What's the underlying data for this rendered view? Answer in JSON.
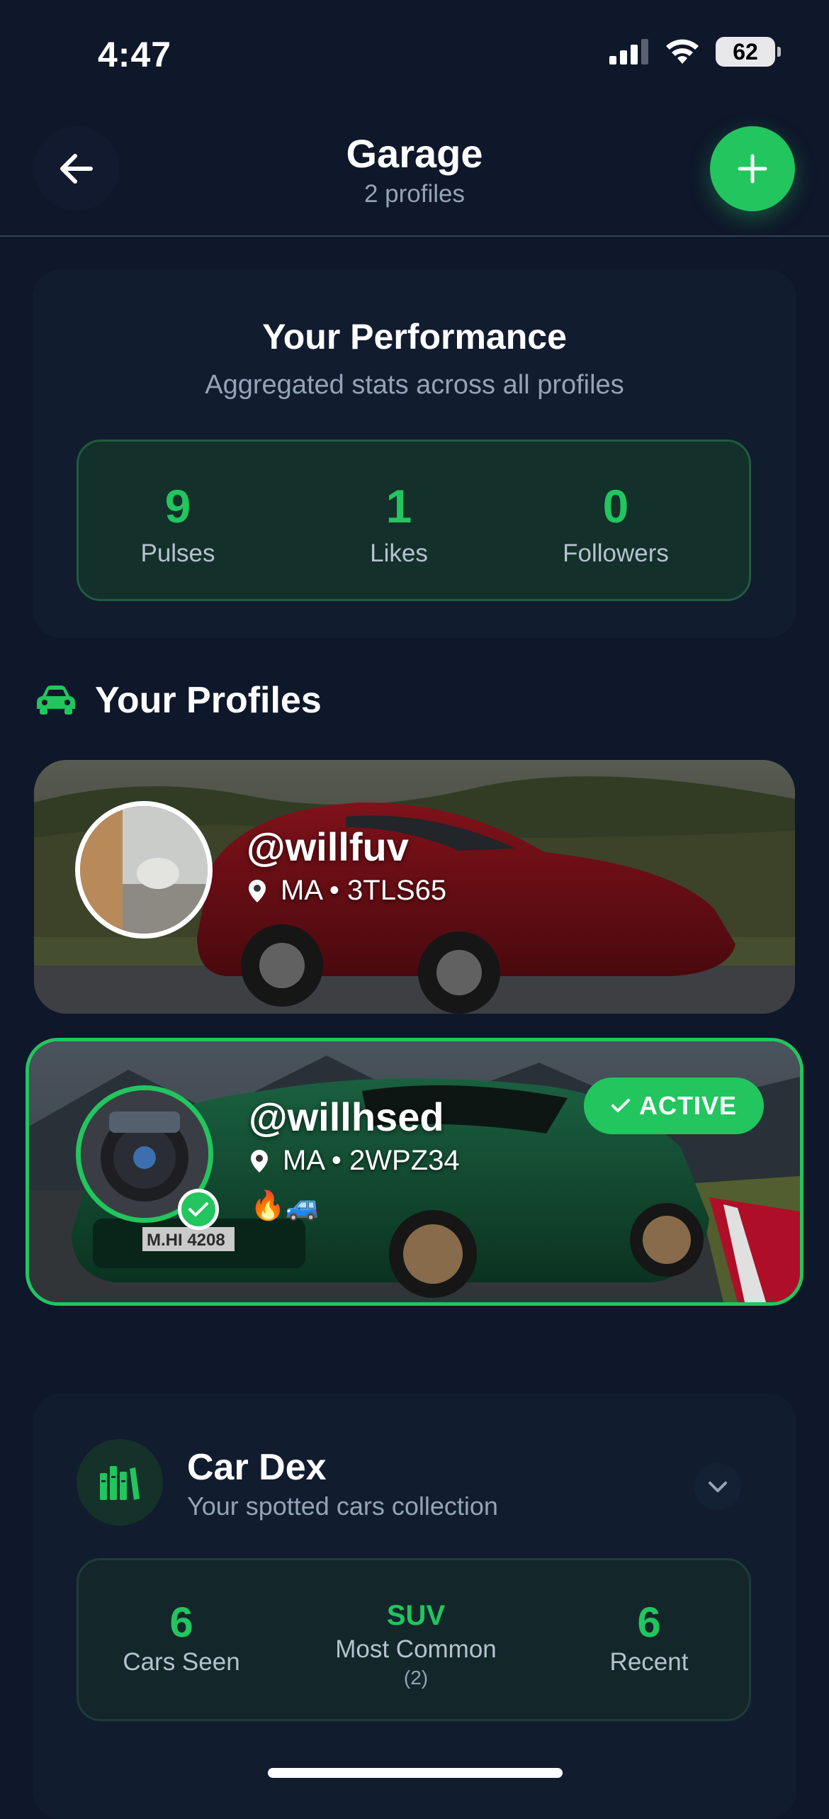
{
  "status_bar": {
    "time": "4:47",
    "battery": "62"
  },
  "header": {
    "title": "Garage",
    "subtitle": "2 profiles"
  },
  "performance": {
    "title": "Your Performance",
    "subtitle": "Aggregated stats across all profiles",
    "stats": [
      {
        "value": "9",
        "label": "Pulses"
      },
      {
        "value": "1",
        "label": "Likes"
      },
      {
        "value": "0",
        "label": "Followers"
      }
    ]
  },
  "profiles_section": {
    "title": "Your Profiles"
  },
  "profiles": [
    {
      "handle": "@willfuv",
      "location": "MA • 3TLS65",
      "emoji": ""
    },
    {
      "handle": "@willhsed",
      "location": "MA • 2WPZ34",
      "emoji": "🔥🚙",
      "badge": "ACTIVE",
      "plate_text": "M.HI 4208"
    }
  ],
  "car_dex": {
    "title": "Car Dex",
    "subtitle": "Your spotted cars collection",
    "stats": [
      {
        "value": "6",
        "label": "Cars Seen"
      },
      {
        "value": "SUV",
        "label": "Most Common",
        "note": "(2)"
      },
      {
        "value": "6",
        "label": "Recent"
      }
    ]
  },
  "colors": {
    "background": "#0f172a",
    "accent": "#22c55e",
    "card": "#121c2f"
  }
}
